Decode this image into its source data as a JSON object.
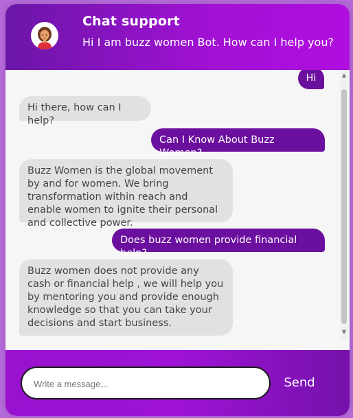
{
  "header": {
    "title": "Chat support",
    "subtitle": "Hi I am buzz women Bot. How can I help you?",
    "avatar_icon": "woman-avatar-icon"
  },
  "messages": [
    {
      "sender": "user",
      "text": "Hi"
    },
    {
      "sender": "bot",
      "text": "Hi there, how can I help?"
    },
    {
      "sender": "user",
      "text": "Can I Know About Buzz Women?"
    },
    {
      "sender": "bot",
      "text": "Buzz Women is the global movement by and for women. We bring transformation within reach and enable women to ignite their personal and collective power."
    },
    {
      "sender": "user",
      "text": "Does buzz women provide financial help?"
    },
    {
      "sender": "bot",
      "text": "Buzz women does not provide any cash or financial help , we will help you by mentoring you and provide enough knowledge so that you can take your decisions and start business."
    }
  ],
  "composer": {
    "placeholder": "Write a message...",
    "value": "",
    "send_label": "Send"
  },
  "colors": {
    "header_start": "#6b16a8",
    "header_end": "#b10ee0",
    "user_bubble": "#6b0f9e",
    "bot_bubble": "#e1e1e1"
  }
}
